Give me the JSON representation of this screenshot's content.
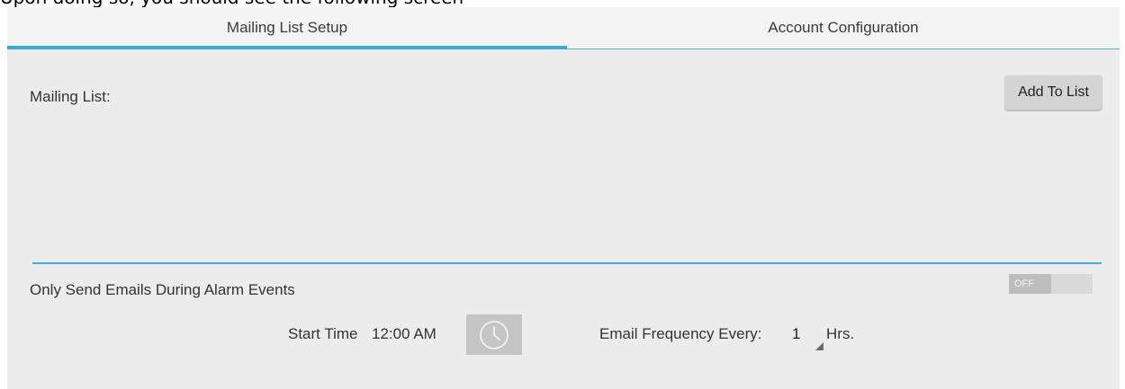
{
  "page_heading": "Upon doing so, you should see the following screen",
  "tabs": [
    {
      "label": "Mailing List Setup",
      "active": true
    },
    {
      "label": "Account Configuration",
      "active": false
    }
  ],
  "mailing": {
    "label": "Mailing List:",
    "add_button_label": "Add To List"
  },
  "alarm": {
    "label": "Only Send Emails During Alarm Events",
    "toggle_state": "OFF"
  },
  "schedule": {
    "start_label": "Start Time",
    "start_value": "12:00 AM",
    "clock_icon": "clock-icon",
    "frequency_label": "Email Frequency Every:",
    "frequency_value": "1",
    "frequency_unit": "Hrs."
  },
  "colors": {
    "accent": "#35a8e0",
    "panel_bg": "#ececec",
    "button_bg": "#d4d4d4"
  }
}
